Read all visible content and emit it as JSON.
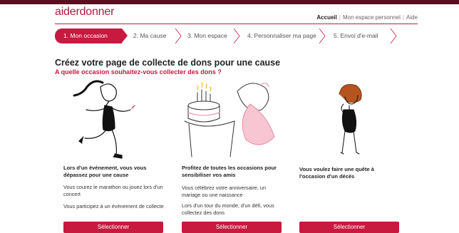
{
  "header": {
    "logo_text": "aiderdonner",
    "nav": [
      {
        "label": "Accueil",
        "active": true
      },
      {
        "label": "Mon espace personnel",
        "active": false
      },
      {
        "label": "Aide",
        "active": false
      }
    ]
  },
  "steps": [
    {
      "label": "1. Mon occasion",
      "active": true
    },
    {
      "label": "2. Ma cause",
      "active": false
    },
    {
      "label": "3. Mon espace",
      "active": false
    },
    {
      "label": "4. Personnaliser ma page",
      "active": false
    },
    {
      "label": "5. Envoi d'e-mail",
      "active": false
    }
  ],
  "main": {
    "title": "Créez votre page de collecte de dons pour une cause",
    "subtitle": "A quelle occasion souhaitez-vous collecter des dons ?"
  },
  "cards": [
    {
      "heading": "Lors d'un événement, vous vous dépassez pour une cause",
      "lines": [
        "Vous courez le marathon ou jouez lors d'un concert",
        "Vous participez à un événement de collecte"
      ],
      "button": "Sélectionner",
      "illustration": "runner-icon"
    },
    {
      "heading": "Profitez de toutes les occasions pour sensibiliser vos amis",
      "lines": [
        "Vous célébrez votre anniversaire, un mariage ou une naissance",
        "Lors d'un tour du monde, d'un défi, vous collectez des dons"
      ],
      "button": "Sélectionner",
      "illustration": "birthday-cake-icon"
    },
    {
      "heading": "Vous voulez faire une quête à l'occasion d'un décès",
      "lines": [],
      "button": "Sélectionner",
      "illustration": "mourning-woman-icon"
    }
  ],
  "colors": {
    "brand": "#c8193f",
    "top_band": "#5a0f1e"
  }
}
